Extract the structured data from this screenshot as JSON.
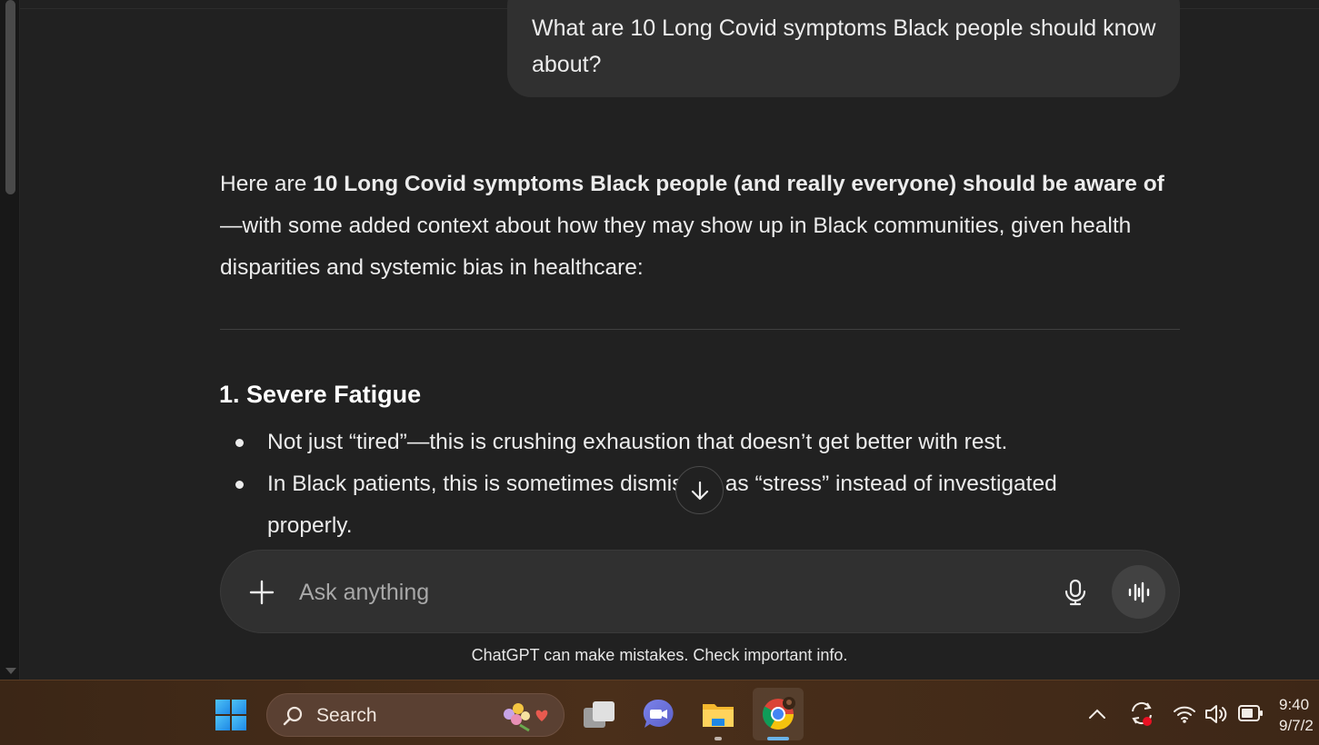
{
  "conversation": {
    "user_message": "What are 10 Long Covid symptoms Black people should know about?",
    "assistant": {
      "intro_pre": "Here are ",
      "intro_bold": "10 Long Covid symptoms Black people (and really everyone) should be aware of",
      "intro_post": "—with some added context about how they may show up in Black communities, given health disparities and systemic bias in healthcare:",
      "section_title": "1. Severe Fatigue",
      "bullets": [
        "Not just “tired”—this is crushing exhaustion that doesn’t get better with rest.",
        "In Black patients, this is sometimes dismissed as “stress” instead of investigated properly."
      ]
    }
  },
  "composer": {
    "placeholder": "Ask anything",
    "add_icon": "plus-icon",
    "mic_icon": "microphone-icon",
    "voice_icon": "voice-mode-icon"
  },
  "disclaimer": "ChatGPT can make mistakes. Check important info.",
  "taskbar": {
    "search_label": "Search",
    "clock_time": "9:40",
    "clock_date": "9/7/2",
    "icons": [
      "windows-start-icon",
      "search-icon",
      "task-view-icon",
      "teams-chat-icon",
      "file-explorer-icon",
      "chrome-icon",
      "chevron-up-icon",
      "sync-icon",
      "wifi-icon",
      "volume-icon",
      "battery-icon"
    ]
  },
  "colors": {
    "background": "#212121",
    "bubble": "#303030",
    "text": "#ececec",
    "taskbar": "#4a2f1a"
  }
}
